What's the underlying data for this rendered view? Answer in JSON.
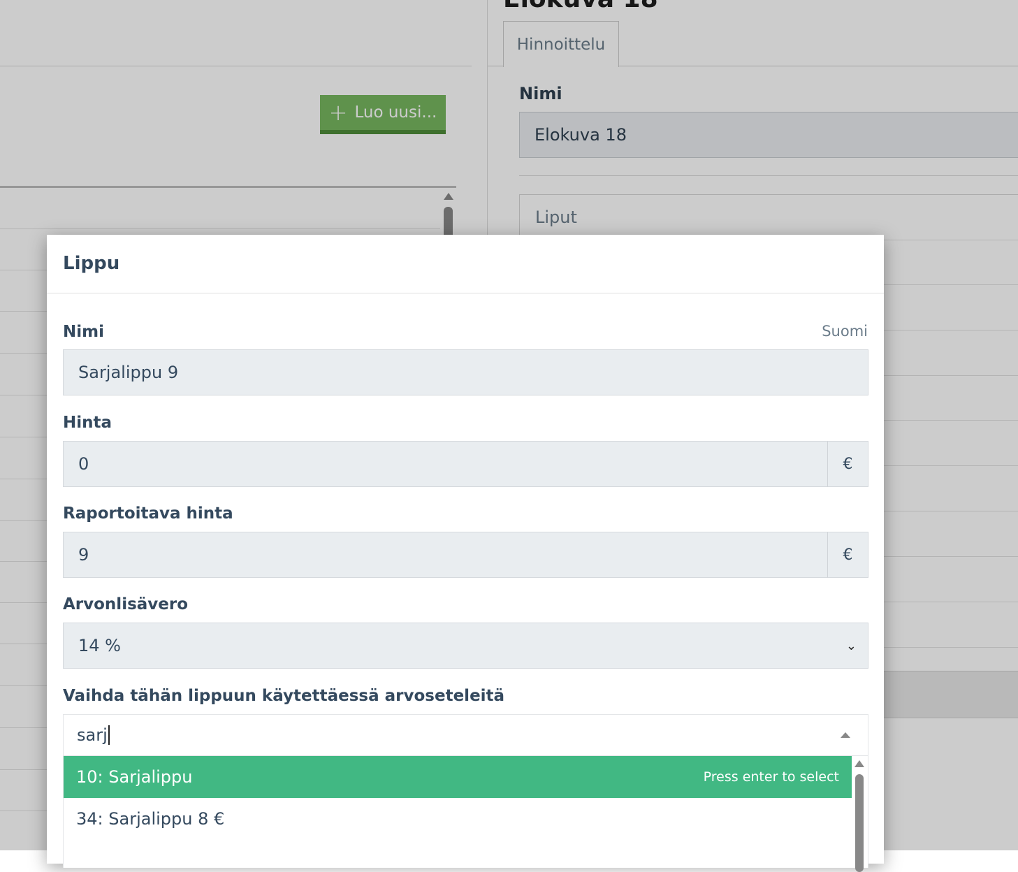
{
  "background": {
    "create_button_label": "Luo uusi...",
    "movie_title": "Elokuva 18",
    "tab_label": "Hinnoittelu",
    "name_label": "Nimi",
    "name_value": "Elokuva 18",
    "tickets_label": "Liput"
  },
  "modal": {
    "title": "Lippu",
    "name": {
      "label": "Nimi",
      "language": "Suomi",
      "value": "Sarjalippu 9"
    },
    "price": {
      "label": "Hinta",
      "value": "0",
      "currency": "€"
    },
    "reported_price": {
      "label": "Raportoitava hinta",
      "value": "9",
      "currency": "€"
    },
    "vat": {
      "label": "Arvonlisävero",
      "selected": "14 %"
    },
    "voucher_switch": {
      "label": "Vaihda tähän lippuun käytettäessä arvoseteleitä",
      "search_text": "sarj",
      "options": [
        {
          "label": "10: Sarjalippu",
          "hint": "Press enter to select",
          "highlighted": true
        },
        {
          "label": "34: Sarjalippu 8 €",
          "hint": "",
          "highlighted": false
        }
      ]
    }
  },
  "colors": {
    "create_button": "#77b75f",
    "highlight": "#41b883",
    "input_bg": "#e9edf0"
  }
}
